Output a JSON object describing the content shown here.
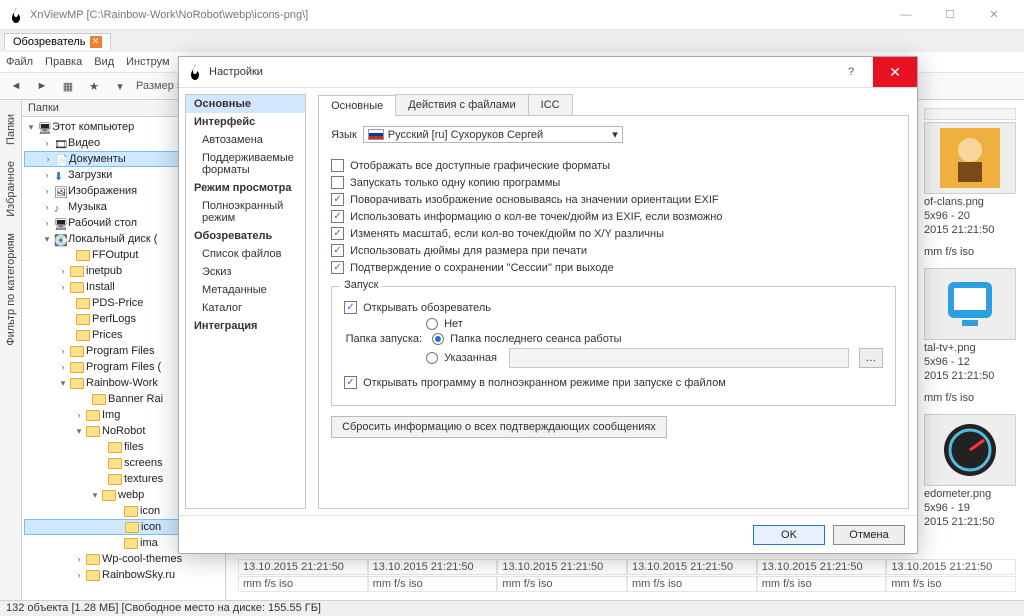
{
  "main_title": "XnViewMP [C:\\Rainbow-Work\\NoRobot\\webp\\icons-png\\]",
  "browser_tab": "Обозреватель",
  "menu": {
    "file": "Файл",
    "edit": "Правка",
    "view": "Вид",
    "tools": "Инструм"
  },
  "toolbar": {
    "size_label": "Размер эск"
  },
  "side_tabs": {
    "folders": "Папки",
    "favorites": "Избранное",
    "filter": "Фильтр по категориям"
  },
  "folders_panel_header": "Папки",
  "tree": {
    "this_pc": "Этот компьютер",
    "video": "Видео",
    "documents": "Документы",
    "downloads": "Загрузки",
    "images": "Изображения",
    "music": "Музыка",
    "desktop": "Рабочий стол",
    "local_disk": "Локальный диск (",
    "ffoutput": "FFOutput",
    "inetpub": "inetpub",
    "install": "Install",
    "pds_price": "PDS-Price",
    "perflogs": "PerfLogs",
    "prices": "Prices",
    "program_files": "Program Files",
    "program_files2": "Program Files (",
    "rainbow_work": "Rainbow-Work",
    "banner_rai": "Banner Rai",
    "img": "Img",
    "norobot": "NoRobot",
    "files_f": "files",
    "screens": "screens",
    "textures": "textures",
    "webp": "webp",
    "icons1": "icon",
    "icons_png": "icon",
    "ima": "ima",
    "wp_cool": "Wp-cool-themes",
    "rainbowsky": "RainbowSky.ru"
  },
  "dialog": {
    "title": "Настройки",
    "categories": {
      "general": "Основные",
      "interface": "Интерфейс",
      "autoreplace": "Автозамена",
      "formats": "Поддерживаемые форматы",
      "view_mode": "Режим просмотра",
      "fullscreen": "Полноэкранный режим",
      "browser": "Обозреватель",
      "filelist": "Список файлов",
      "sketch": "Эскиз",
      "metadata": "Метаданные",
      "catalog": "Каталог",
      "integration": "Интеграция"
    },
    "inner_tabs": {
      "general": "Основные",
      "file_ops": "Действия с файлами",
      "icc": "ICC"
    },
    "lang_label": "Язык",
    "lang_value": "Русский [ru] Сухоруков Сергей",
    "checks": {
      "all_formats": "Отображать все доступные графические форматы",
      "single_copy": "Запускать только одну копию программы",
      "rotate_exif": "Поворачивать изображение основываясь на значении ориентации EXIF",
      "dpi_exif": "Использовать информацию о кол-ве точек/дюйм из EXIF, если возможно",
      "scale_xy": "Изменять масштаб, если кол-во точек/дюйм по X/Y различны",
      "inches_print": "Использовать дюймы для размера при печати",
      "session_confirm": "Подтверждение о сохранении \"Сессии\" при выходе"
    },
    "startup": {
      "legend": "Запуск",
      "open_browser": "Открывать обозреватель",
      "none": "Нет",
      "startup_folder_label": "Папка запуска:",
      "last_session": "Папка последнего сеанса работы",
      "specified": "Указанная",
      "fullscreen_on_file": "Открывать программу в полноэкранном режиме при запуске с файлом"
    },
    "reset_button": "Сбросить информацию о всех подтверждающих сообщениях",
    "ok": "OK",
    "cancel": "Отмена"
  },
  "thumbs": {
    "t1_name": "of-clans.png",
    "t1_size": "5x96 - 20",
    "t1_date": "2015 21:21:50",
    "meta_row": "mm f/s iso",
    "t2_name": "tal-tv+.png",
    "t2_size": "5x96 - 12",
    "t2_date": "2015 21:21:50",
    "t3_name": "edometer.png",
    "t3_size": "5x96 - 19",
    "t3_date": "2015 21:21:50"
  },
  "info_row_date": "13.10.2015 21:21:50",
  "info_row_meta": "mm f/s iso",
  "statusbar": "132 объекта [1.28 МБ]   [Свободное место на диске: 155.55 ГБ]"
}
